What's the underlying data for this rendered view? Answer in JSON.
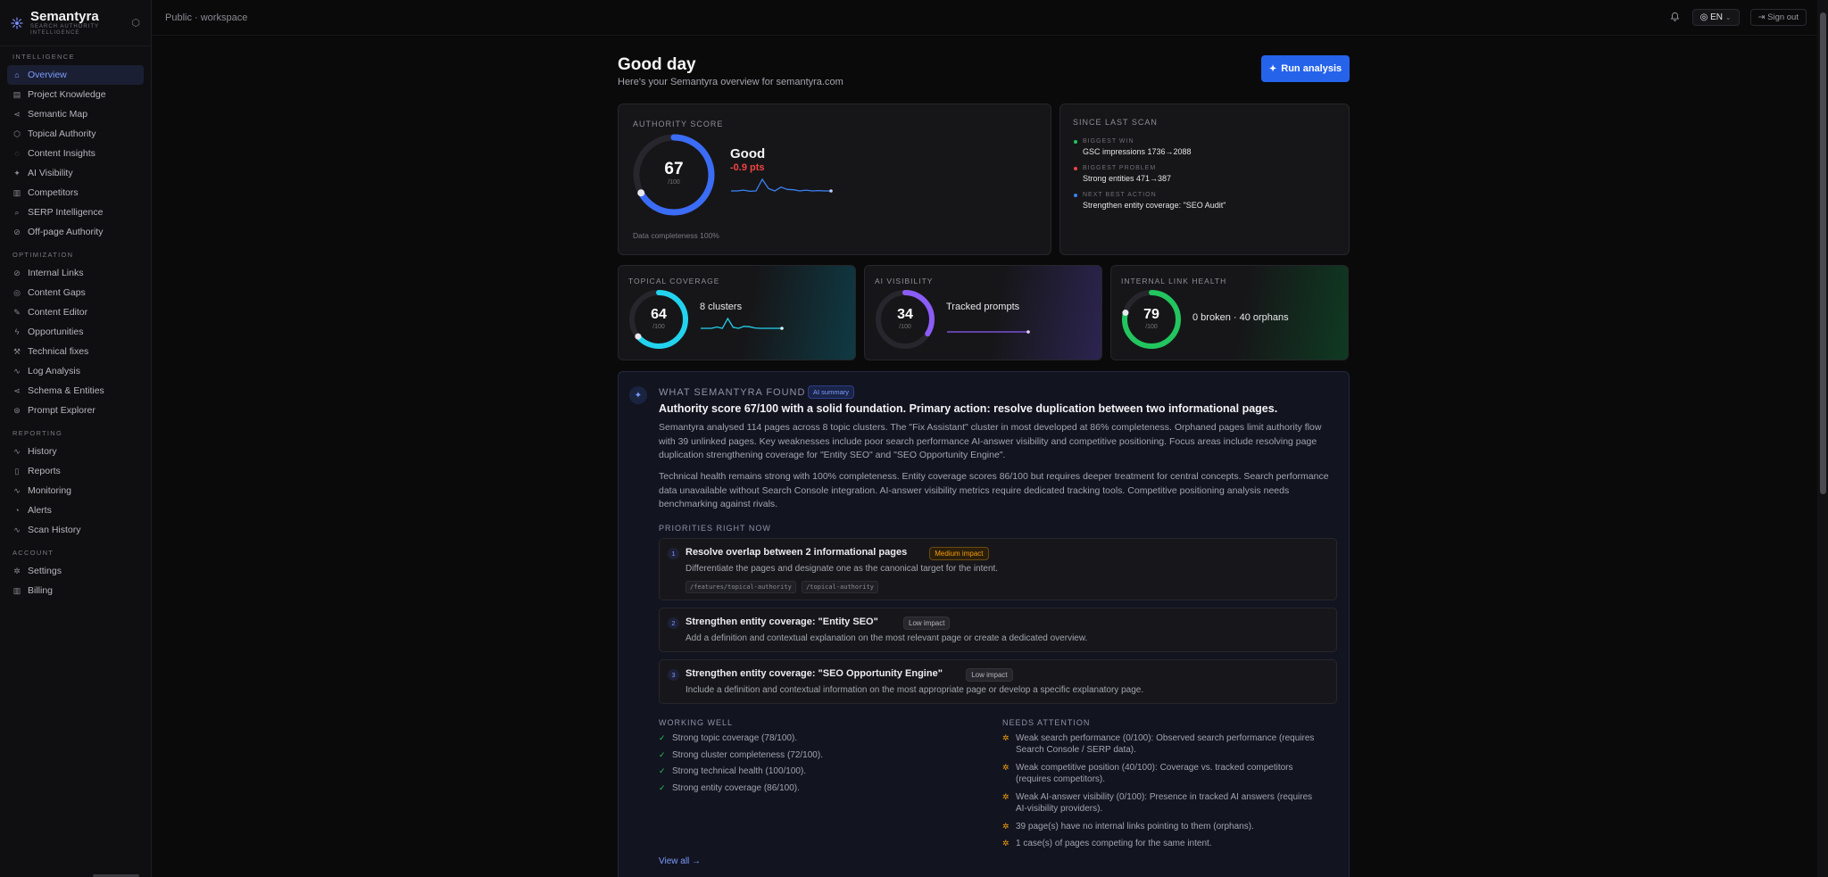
{
  "brand": {
    "name": "Semantyra",
    "subtitle_line1": "SEARCH AUTHORITY",
    "subtitle_line2": "INTELLIGENCE"
  },
  "sidebar": {
    "sections": [
      {
        "label": "INTELLIGENCE",
        "items": [
          {
            "label": "Overview",
            "icon": "home-icon",
            "active": true
          },
          {
            "label": "Project Knowledge",
            "icon": "book-icon"
          },
          {
            "label": "Semantic Map",
            "icon": "share-icon"
          },
          {
            "label": "Topical Authority",
            "icon": "shield-icon"
          },
          {
            "label": "Content Insights",
            "icon": "bulb-icon"
          },
          {
            "label": "AI Visibility",
            "icon": "sparkle-icon"
          },
          {
            "label": "Competitors",
            "icon": "chart-icon"
          },
          {
            "label": "SERP Intelligence",
            "icon": "search-icon"
          },
          {
            "label": "Off-page Authority",
            "icon": "link-icon"
          }
        ]
      },
      {
        "label": "OPTIMIZATION",
        "items": [
          {
            "label": "Internal Links",
            "icon": "link-icon"
          },
          {
            "label": "Content Gaps",
            "icon": "target-icon"
          },
          {
            "label": "Content Editor",
            "icon": "edit-icon"
          },
          {
            "label": "Opportunities",
            "icon": "bolt-icon"
          },
          {
            "label": "Technical fixes",
            "icon": "wrench-icon"
          },
          {
            "label": "Log Analysis",
            "icon": "pulse-icon"
          },
          {
            "label": "Schema & Entities",
            "icon": "share-icon"
          },
          {
            "label": "Prompt Explorer",
            "icon": "compass-icon"
          }
        ]
      },
      {
        "label": "REPORTING",
        "items": [
          {
            "label": "History",
            "icon": "pulse-icon"
          },
          {
            "label": "Reports",
            "icon": "file-icon"
          },
          {
            "label": "Monitoring",
            "icon": "pulse-icon"
          },
          {
            "label": "Alerts",
            "icon": "bell-icon"
          },
          {
            "label": "Scan History",
            "icon": "pulse-icon"
          }
        ]
      },
      {
        "label": "ACCOUNT",
        "items": [
          {
            "label": "Settings",
            "icon": "gear-icon"
          },
          {
            "label": "Billing",
            "icon": "chart-icon"
          }
        ]
      }
    ]
  },
  "topbar": {
    "workspace": "Public · workspace",
    "lang": "EN",
    "signout": "Sign out"
  },
  "header": {
    "greeting": "Good day",
    "subtitle": "Here's your Semantyra overview for semantyra.com",
    "run_button": "Run analysis"
  },
  "authority": {
    "label": "AUTHORITY SCORE",
    "score": "67",
    "max": "/100",
    "score_value": 67,
    "status": "Good",
    "delta": "-0.9 pts",
    "completeness": "Data completeness 100%",
    "sparkline": [
      3,
      3,
      3.2,
      2.9,
      3,
      6,
      3.6,
      3,
      4,
      3.4,
      3.3,
      3,
      3.2,
      3,
      3.1,
      3,
      3
    ]
  },
  "since": {
    "label": "SINCE LAST SCAN",
    "items": [
      {
        "key": "BIGGEST WIN",
        "value": "GSC impressions 1736→2088",
        "color": "#22c55e"
      },
      {
        "key": "BIGGEST PROBLEM",
        "value": "Strong entities 471→387",
        "color": "#ef4444"
      },
      {
        "key": "NEXT BEST ACTION",
        "value": "Strengthen entity coverage: \"SEO Audit\"",
        "color": "#3b82f6"
      }
    ]
  },
  "cards": {
    "topical": {
      "label": "TOPICAL COVERAGE",
      "score": "64",
      "max": "/100",
      "score_value": 64,
      "text": "8 clusters",
      "color": "#22d3ee",
      "sparkline": [
        3,
        3,
        3,
        3.4,
        3,
        6,
        3.3,
        3,
        3.6,
        3.5,
        3.1,
        3,
        3,
        3,
        3,
        3
      ]
    },
    "ai": {
      "label": "AI VISIBILITY",
      "score": "34",
      "max": "/100",
      "score_value": 34,
      "text": "Tracked prompts",
      "color": "#8b5cf6",
      "sparkline": [
        3,
        3,
        3,
        3,
        3,
        3,
        3,
        3,
        3,
        3,
        3,
        3,
        3,
        3,
        3,
        3
      ]
    },
    "links": {
      "label": "INTERNAL LINK HEALTH",
      "score": "79",
      "max": "/100",
      "score_value": 79,
      "text": "0 broken · 40 orphans",
      "color": "#22c55e"
    }
  },
  "found": {
    "label": "WHAT SEMANTYRA FOUND",
    "badge": "AI summary",
    "title": "Authority score 67/100 with a solid foundation. Primary action: resolve duplication between two informational pages.",
    "para1": "Semantyra analysed 114 pages across 8 topic clusters. The \"Fix Assistant\" cluster in most developed at 86% completeness. Orphaned pages limit authority flow with 39 unlinked pages. Key weaknesses include poor search performance AI-answer visibility and competitive positioning. Focus areas include resolving page duplication strengthening coverage for \"Entity SEO\" and \"SEO Opportunity Engine\".",
    "para2": "Technical health remains strong with 100% completeness. Entity coverage scores 86/100 but requires deeper treatment for central concepts. Search performance data unavailable without Search Console integration. AI-answer visibility metrics require dedicated tracking tools. Competitive positioning analysis needs benchmarking against rivals.",
    "priorities_label": "PRIORITIES RIGHT NOW",
    "priorities": [
      {
        "num": "1",
        "title": "Resolve overlap between 2 informational pages",
        "badge": "Medium impact",
        "desc": "Differentiate the pages and designate one as the canonical target for the intent.",
        "chips": [
          "/features/topical-authority",
          "/topical-authority"
        ]
      },
      {
        "num": "2",
        "title": "Strengthen entity coverage: \"Entity SEO\"",
        "badge": "Low impact",
        "desc": "Add a definition and contextual explanation on the most relevant page or create a dedicated overview."
      },
      {
        "num": "3",
        "title": "Strengthen entity coverage: \"SEO Opportunity Engine\"",
        "badge": "Low impact",
        "desc": "Include a definition and contextual information on the most appropriate page or develop a specific explanatory page."
      }
    ],
    "working_label": "WORKING WELL",
    "working": [
      "Strong topic coverage (78/100).",
      "Strong cluster completeness (72/100).",
      "Strong technical health (100/100).",
      "Strong entity coverage (86/100)."
    ],
    "attention_label": "NEEDS ATTENTION",
    "attention": [
      "Weak search performance (0/100): Observed search performance (requires Search Console / SERP data).",
      "Weak competitive position (40/100): Coverage vs. tracked competitors (requires competitors).",
      "Weak AI-answer visibility (0/100): Presence in tracked AI answers (requires AI-visibility providers).",
      "39 page(s) have no internal links pointing to them (orphans).",
      "1 case(s) of pages competing for the same intent."
    ],
    "view_all": "View all →"
  }
}
